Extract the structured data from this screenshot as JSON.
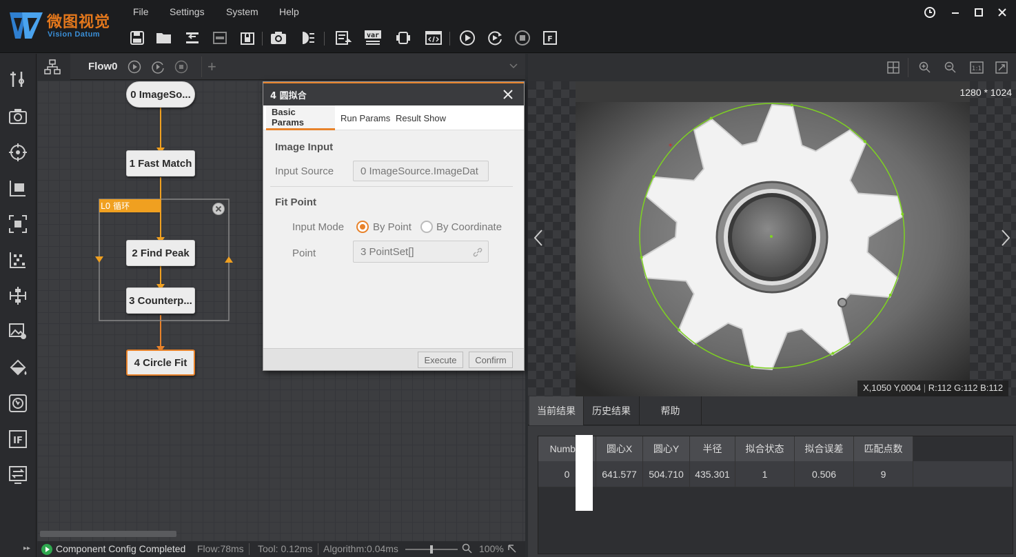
{
  "app": {
    "logo_cn": "微图视觉",
    "logo_en": "Vision Datum",
    "menu": [
      "File",
      "Settings",
      "System",
      "Help"
    ]
  },
  "flow": {
    "title": "Flow0",
    "nodes": [
      {
        "label": "0 ImageSo..."
      },
      {
        "label": "1 Fast Match"
      },
      {
        "label": "2 Find Peak"
      },
      {
        "label": "3 Counterp..."
      },
      {
        "label": "4 Circle Fit"
      }
    ],
    "loop_label": "L0 循环"
  },
  "dialog": {
    "title": "4 圆拟合",
    "tabs": [
      "Basic Params",
      "Run Params",
      "Result Show"
    ],
    "image_input_header": "Image Input",
    "input_source_label": "Input Source",
    "input_source_value": "0 ImageSource.ImageDat",
    "fit_point_header": "Fit Point",
    "input_mode_label": "Input Mode",
    "mode_options": [
      "By Point",
      "By Coordinate"
    ],
    "selected_mode": "By Point",
    "point_label": "Point",
    "point_value": "3 PointSet[]",
    "execute_label": "Execute",
    "confirm_label": "Confirm"
  },
  "status": {
    "message": "Component Config Completed",
    "flow_time": "Flow:78ms",
    "tool_time": "Tool: 0.12ms",
    "algo_time": "Algorithm:0.04ms",
    "zoom": "100%",
    "zoom_fraction": 0.5
  },
  "image": {
    "size": "1280 * 1024",
    "coords": "X,1050  Y,0004",
    "rgb": "R:112  G:112  B:112"
  },
  "results": {
    "tabs": [
      "当前结果",
      "历史结果",
      "帮助"
    ],
    "columns": [
      "Number",
      "圆心X",
      "圆心Y",
      "半径",
      "拟合状态",
      "拟合误差",
      "匹配点数"
    ],
    "rows": [
      [
        "0",
        "641.577",
        "504.710",
        "435.301",
        "1",
        "0.506",
        "9"
      ]
    ]
  },
  "colors": {
    "accent": "#e8822a",
    "fit_circle": "#7ed321",
    "loop": "#f0a020"
  }
}
